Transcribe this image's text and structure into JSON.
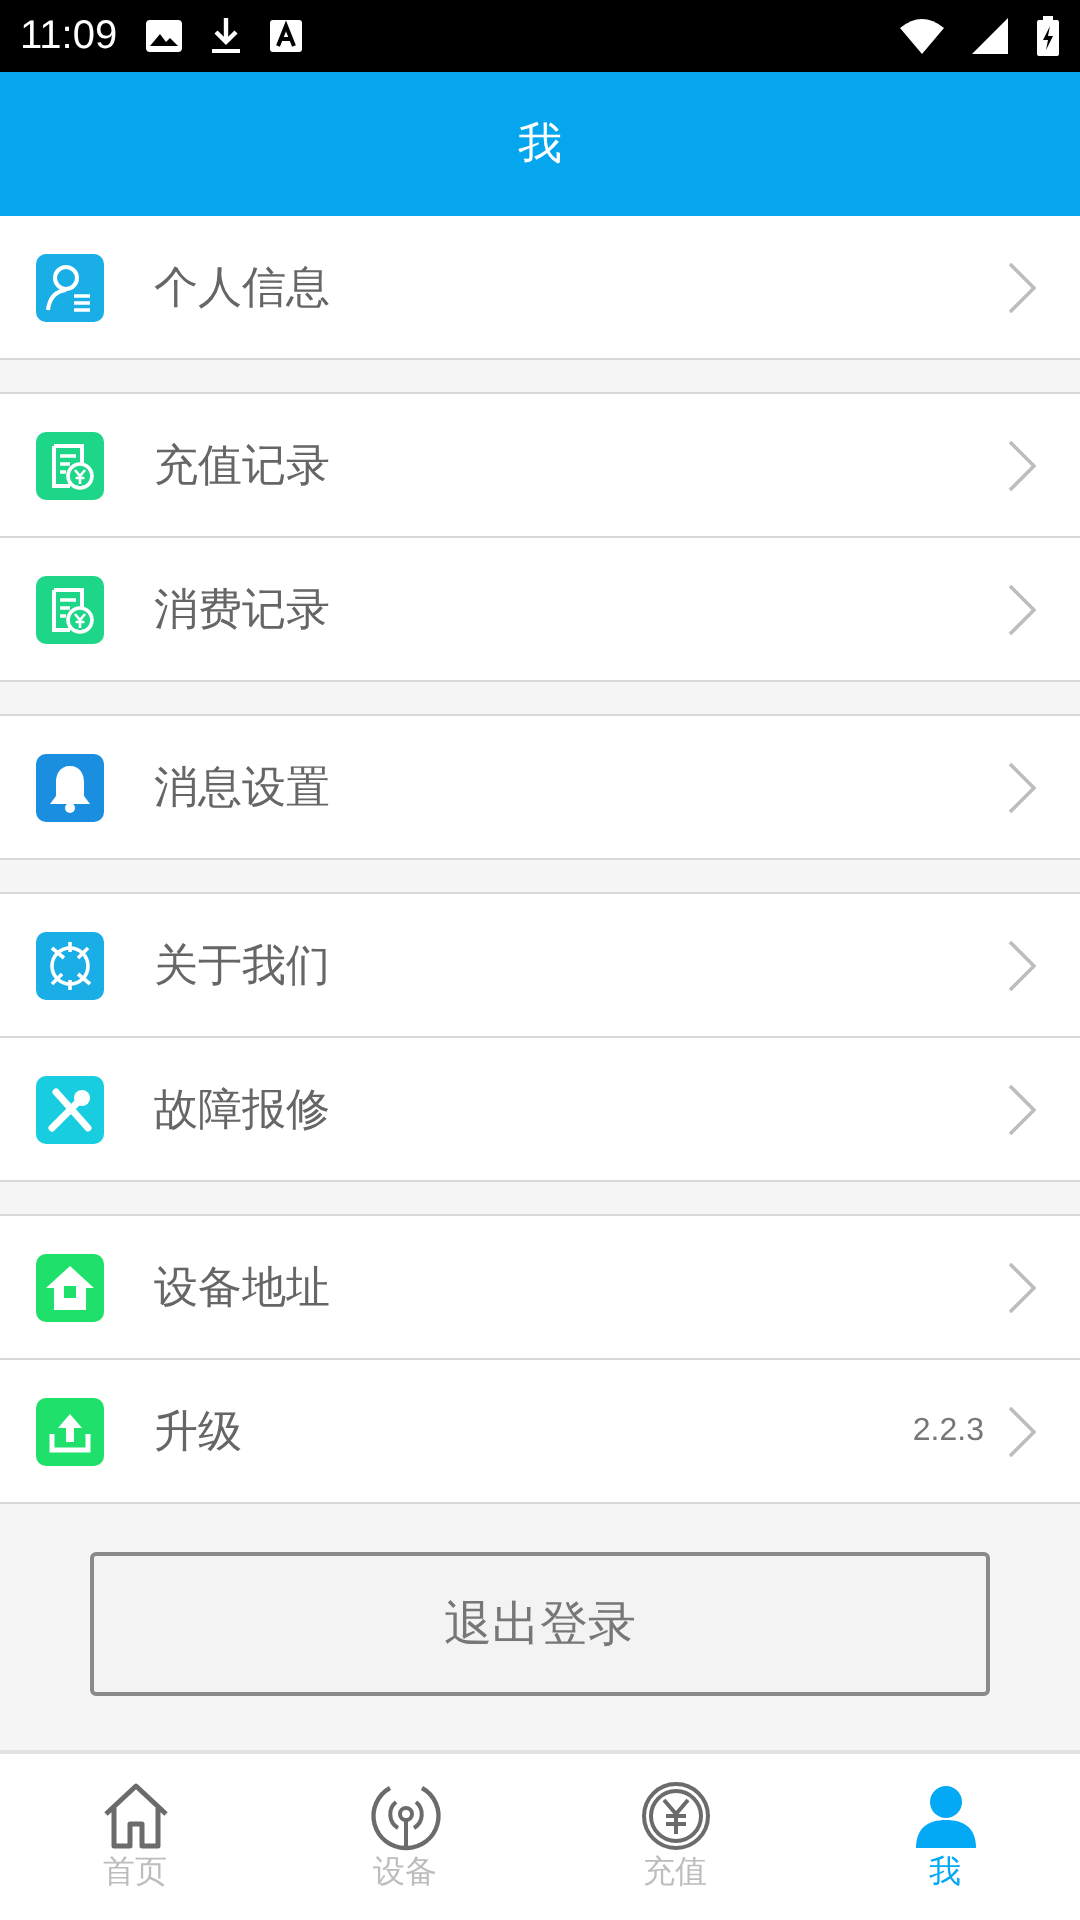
{
  "status_bar": {
    "time": "11:09"
  },
  "header": {
    "title": "我"
  },
  "groups": [
    {
      "items": [
        {
          "label": "个人信息"
        }
      ]
    },
    {
      "items": [
        {
          "label": "充值记录"
        },
        {
          "label": "消费记录"
        }
      ]
    },
    {
      "items": [
        {
          "label": "消息设置"
        }
      ]
    },
    {
      "items": [
        {
          "label": "关于我们"
        },
        {
          "label": "故障报修"
        }
      ]
    },
    {
      "items": [
        {
          "label": "设备地址"
        },
        {
          "label": "升级",
          "value": "2.2.3"
        }
      ]
    }
  ],
  "logout_button": {
    "label": "退出登录"
  },
  "tabs": [
    {
      "label": "首页",
      "selected": false
    },
    {
      "label": "设备",
      "selected": false
    },
    {
      "label": "充值",
      "selected": false
    },
    {
      "label": "我",
      "selected": true
    }
  ]
}
